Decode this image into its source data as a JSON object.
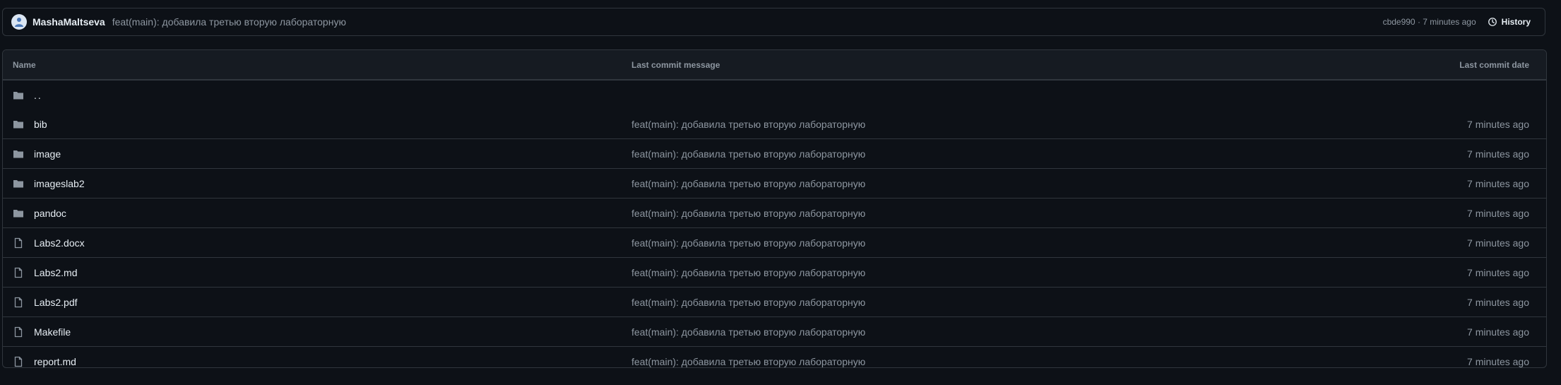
{
  "latest_commit": {
    "author": "MashaMaltseva",
    "message": "feat(main): добавила третью вторую лабораторную",
    "meta": "cbde990 · 7 minutes ago",
    "history_label": "History"
  },
  "table": {
    "headers": {
      "name": "Name",
      "message": "Last commit message",
      "date": "Last commit date"
    },
    "parent": "..",
    "rows": [
      {
        "name": "bib",
        "type": "folder",
        "message": "feat(main): добавила третью вторую лабораторную",
        "date": "7 minutes ago"
      },
      {
        "name": "image",
        "type": "folder",
        "message": "feat(main): добавила третью вторую лабораторную",
        "date": "7 minutes ago"
      },
      {
        "name": "imageslab2",
        "type": "folder",
        "message": "feat(main): добавила третью вторую лабораторную",
        "date": "7 minutes ago"
      },
      {
        "name": "pandoc",
        "type": "folder",
        "message": "feat(main): добавила третью вторую лабораторную",
        "date": "7 minutes ago"
      },
      {
        "name": "Labs2.docx",
        "type": "file",
        "message": "feat(main): добавила третью вторую лабораторную",
        "date": "7 minutes ago"
      },
      {
        "name": "Labs2.md",
        "type": "file",
        "message": "feat(main): добавила третью вторую лабораторную",
        "date": "7 minutes ago"
      },
      {
        "name": "Labs2.pdf",
        "type": "file",
        "message": "feat(main): добавила третью вторую лабораторную",
        "date": "7 minutes ago"
      },
      {
        "name": "Makefile",
        "type": "file",
        "message": "feat(main): добавила третью вторую лабораторную",
        "date": "7 minutes ago"
      },
      {
        "name": "report.md",
        "type": "file",
        "message": "feat(main): добавила третью вторую лабораторную",
        "date": "7 minutes ago"
      }
    ]
  }
}
